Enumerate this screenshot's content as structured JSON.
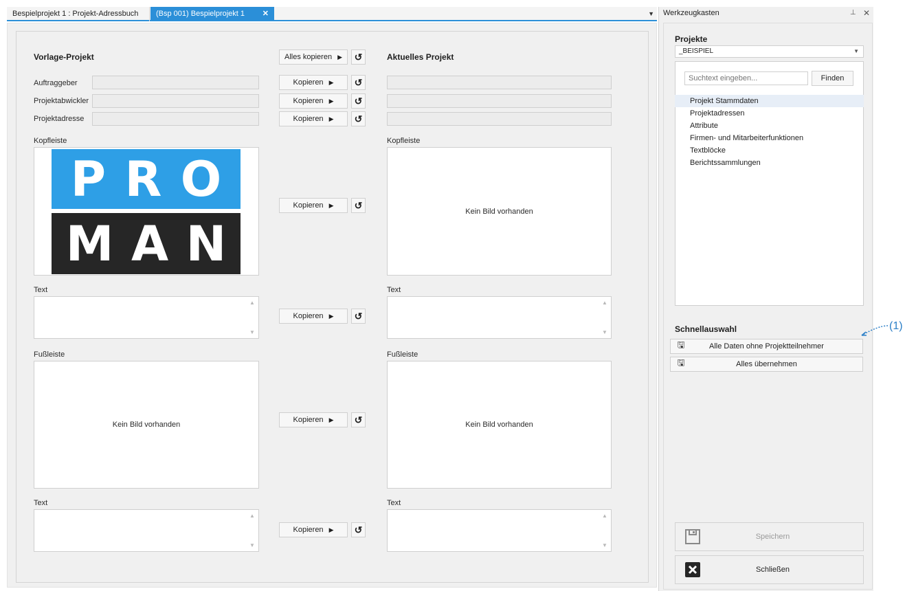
{
  "tabs": [
    {
      "label": "Bespielprojekt 1 : Projekt-Adressbuch"
    },
    {
      "label": "(Bsp 001) Bespielprojekt 1"
    }
  ],
  "tab_close": "✕",
  "tab_dropdown": "▼",
  "left": {
    "vorlage_heading": "Vorlage-Projekt",
    "aktuelles_heading": "Aktuelles Projekt",
    "alles_kopieren": "Alles kopieren",
    "fields": [
      {
        "label": "Auftraggeber",
        "value_vorlage": "",
        "value_aktuell": ""
      },
      {
        "label": "Projektabwickler",
        "value_vorlage": "",
        "value_aktuell": ""
      },
      {
        "label": "Projektadresse",
        "value_vorlage": "",
        "value_aktuell": ""
      }
    ],
    "kopieren": "Kopieren",
    "kopfleiste": "Kopfleiste",
    "fussleiste": "Fußleiste",
    "text": "Text",
    "kein_bild": "Kein Bild vorhanden",
    "logo_top": [
      "P",
      "R",
      "O"
    ],
    "logo_bottom": [
      "M",
      "A",
      "N"
    ]
  },
  "toolbox": {
    "title": "Werkzeugkasten",
    "pin": "📌",
    "close": "✕",
    "projekte_heading": "Projekte",
    "projekt_selected": "_BEISPIEL",
    "search_placeholder": "Suchtext eingeben...",
    "finden": "Finden",
    "list": [
      "Projekt Stammdaten",
      "Projektadressen",
      "Attribute",
      "Firmen- und Mitarbeiterfunktionen",
      "Textblöcke",
      "Berichtssammlungen"
    ],
    "selected_index": 0,
    "schnellauswahl_heading": "Schnellauswahl",
    "quick": [
      {
        "label": "Alle Daten ohne Projektteilnehmer",
        "icon": "save-partial-icon"
      },
      {
        "label": "Alles übernehmen",
        "icon": "save-all-icon"
      }
    ],
    "speichern": "Speichern",
    "schliessen": "Schließen"
  },
  "annotation": "(1)",
  "colors": {
    "accent": "#2b8fd8",
    "logo_blue": "#2e9fe6",
    "logo_dark": "#262626"
  }
}
